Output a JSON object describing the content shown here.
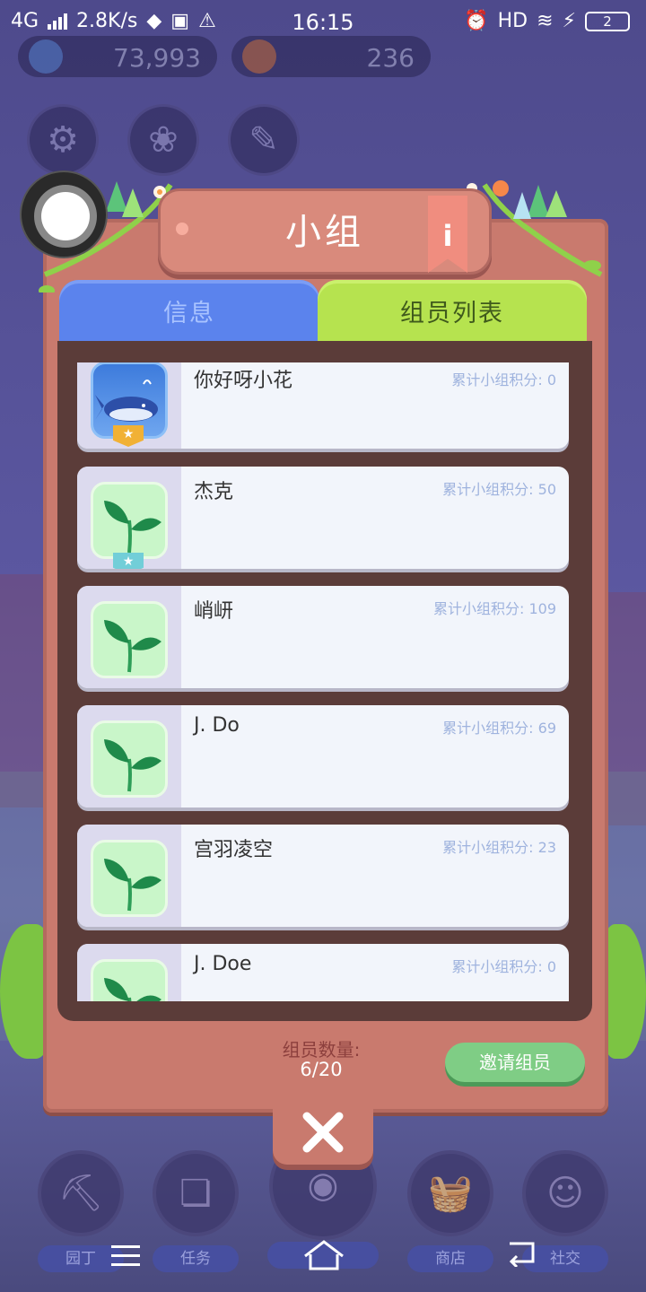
{
  "status_bar": {
    "network": "4G",
    "speed": "2.8K/s",
    "time": "16:15",
    "hd": "HD",
    "battery": "2"
  },
  "resources": {
    "water": "73,993",
    "sun": "236"
  },
  "dialog": {
    "title": "小组",
    "info_button": "i",
    "tabs": [
      {
        "label": "信息",
        "selected": false
      },
      {
        "label": "组员列表",
        "selected": true
      }
    ],
    "score_label": "累计小组积分:",
    "members": [
      {
        "name": "你好呀小花",
        "score": "0",
        "avatar": "whale-avatar",
        "medal": "gold"
      },
      {
        "name": "杰克",
        "score": "50",
        "avatar": "sprout-avatar",
        "medal": "silver"
      },
      {
        "name": "峭岍",
        "score": "109",
        "avatar": "sprout-avatar",
        "medal": ""
      },
      {
        "name": "J. Do",
        "score": "69",
        "avatar": "sprout-avatar",
        "medal": ""
      },
      {
        "name": "宫羽凌空",
        "score": "23",
        "avatar": "sprout-avatar",
        "medal": ""
      },
      {
        "name": "J. Doe",
        "score": "0",
        "avatar": "sprout-avatar",
        "medal": ""
      }
    ],
    "member_count_label": "组员数量:",
    "member_count": "6/20",
    "invite_button": "邀请组员"
  },
  "bottom_nav": {
    "items": [
      "园丁",
      "任务",
      "",
      "商店",
      "社交"
    ]
  },
  "colors": {
    "dialog": "#c97a6e",
    "tab_info": "#5b83ed",
    "tab_members": "#b6e34f",
    "invite": "#7fcd85"
  }
}
